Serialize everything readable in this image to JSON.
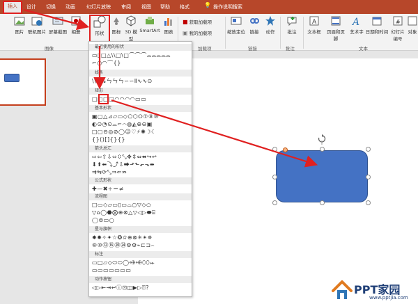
{
  "tabs": [
    "插入",
    "设计",
    "切换",
    "动画",
    "幻灯片放映",
    "审阅",
    "视图",
    "帮助",
    "格式",
    "操作说明搜索"
  ],
  "ribbon": {
    "buttons": [
      "图片",
      "联机图片",
      "屏幕截图",
      "相册",
      "形状",
      "图标",
      "3D 模型",
      "SmartArt",
      "图表",
      "获取加载项",
      "我的加载项",
      "缩放定位",
      "链接",
      "动作",
      "批注",
      "文本框",
      "页眉和页脚",
      "艺术字",
      "日期和时间",
      "幻灯片 编号",
      "对象"
    ],
    "groups": [
      "图像",
      "加载项",
      "链接",
      "批注",
      "文本"
    ]
  },
  "gallery": {
    "sections": [
      "最近使用的形状",
      "线条",
      "矩形",
      "基本形状",
      "箭头总汇",
      "公式形状",
      "流程图",
      "星与旗帜",
      "标注",
      "动作按钮"
    ],
    "rows": {
      "recent": [
        "▭▯□△\\\\□\\□⌒⌒⌒⌓⌓⌓⌓⌓",
        "⌐○◠⌒{}"
      ],
      "lines": [
        "\\\\↘↘ㄣㄣㄣ∽∽Ⅱ∿∿⊙"
      ],
      "rect": [
        "□□□□◠◠◠◠▭▭"
      ],
      "basic": [
        "▣▢△⊿▱▭◇⬠⬡⭘⑦⑧⑩",
        "◐⊙◔⊙⌓⌐⌒◍◭⊕⊖▣",
        "□▢⊝◎⊘◯☺♡⚡✺☽☾",
        "{}()[]{}{}"
      ],
      "arrows": [
        "⇨⇦⇧⇩⬄⇳⤡✥⇕⇔⬌↪↩",
        "⬇⬆⬅⤵⤴⇩⮕⬏⬑⬐⬎⬌",
        "⇉⇆⟳⤡⇒⇐⇏",
        "⇔⇑⇓"
      ],
      "equation": [
        "✚—✖÷＝≠"
      ],
      "flow": [
        "□▭◇▱▭▯▭⌓○▽◇⬭",
        "▽⌂◯⬣⨂⊕⊗△▽◁▷⬬⌸",
        "◯⊜▭○"
      ],
      "stars": [
        "✸✹✧✦☆✪✫⊕⊗✳✴✵",
        "⑧⑩⑫⑯⑳㉔⚙⚙⌁⊏⊐⌢"
      ],
      "callouts": [
        "▭□▱◇⬭⬭◯⬲⬲⬯⬯⬰",
        "▭▭▭▭▭▭▭"
      ],
      "action": [
        "◁▷⇤⇥↩ⓘ⊡◫▶▷⍰?"
      ]
    }
  },
  "watermark": {
    "title": "PPT家园",
    "url": "www.pptjia.com"
  },
  "colors": {
    "accent": "#b7472a",
    "highlight": "#e02020",
    "shape_fill": "#4472c4",
    "shape_stroke": "#2f528f"
  },
  "icons": [
    "picture-icon",
    "online-picture-icon",
    "screenshot-icon",
    "album-icon",
    "shapes-icon",
    "icons-icon",
    "3d-model-icon",
    "smartart-icon",
    "chart-icon",
    "store-icon",
    "my-addins-icon",
    "zoom-icon",
    "link-icon",
    "action-icon",
    "comment-icon",
    "textbox-icon",
    "header-footer-icon",
    "wordart-icon",
    "date-time-icon",
    "slide-number-icon",
    "object-icon",
    "lightbulb-icon",
    "rotate-handle-icon",
    "house-logo-icon"
  ]
}
